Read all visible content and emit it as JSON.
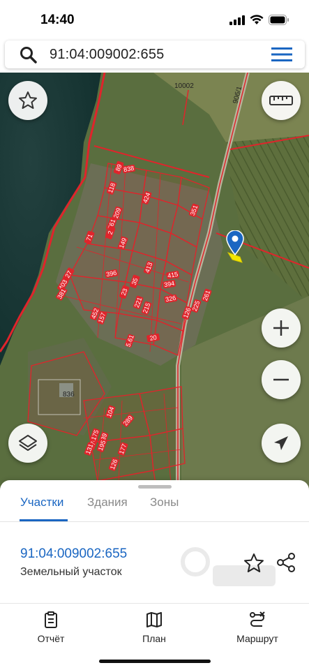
{
  "status_bar": {
    "time": "14:40"
  },
  "search": {
    "query": "91:04:009002:655"
  },
  "map": {
    "area_labels": [
      "10002",
      "90б/1",
      "836"
    ],
    "plot_labels": [
      "838",
      "89",
      "118",
      "424",
      "351",
      "209",
      "761",
      "2",
      "149",
      "71",
      "413",
      "396",
      "27",
      "403",
      "381",
      "23",
      "415",
      "394",
      "326",
      "261",
      "225",
      "126",
      "157",
      "20",
      "5.61",
      "176",
      "139",
      "104",
      "289",
      "131",
      "175",
      "195",
      "177",
      "126",
      "452",
      "35",
      "221",
      "215"
    ]
  },
  "sheet": {
    "tabs": [
      "Участки",
      "Здания",
      "Зоны"
    ],
    "active_tab": 0,
    "parcel": {
      "id": "91:04:009002:655",
      "type": "Земельный участок"
    }
  },
  "bottom_nav": {
    "items": [
      "Отчёт",
      "План",
      "Маршрут"
    ]
  },
  "colors": {
    "accent": "#1a66c2",
    "parcel_lines": "#e0242b",
    "selected_parcel": "#f2e600",
    "marker": "#1a66c2"
  }
}
